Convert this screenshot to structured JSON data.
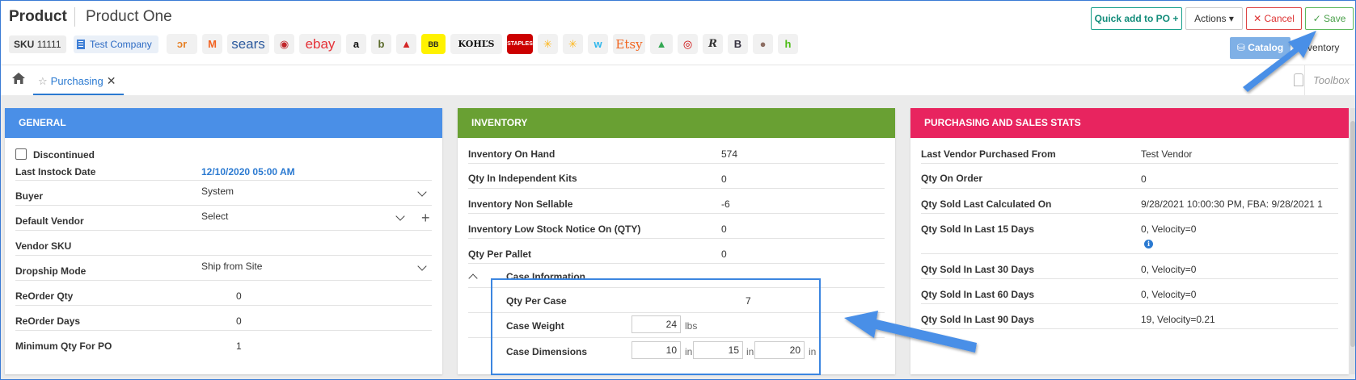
{
  "header": {
    "title": "Product",
    "subtitle": "Product One",
    "sku_label": "SKU",
    "sku_value": "11111",
    "company": "Test Company",
    "buttons": {
      "quick_add": "Quick add to PO +",
      "actions": "Actions ▾",
      "cancel": "✕ Cancel",
      "save": "✓ Save",
      "catalog": "Catalog",
      "inventory": "Inventory"
    }
  },
  "channels": [
    {
      "name": "channeladvisor-logo",
      "text": "ɔr",
      "color": "#e67e22",
      "w": 38
    },
    {
      "name": "magento-logo",
      "text": "M",
      "color": "#f26322",
      "w": 25
    },
    {
      "name": "sears-logo",
      "text": "sears",
      "color": "#2c5a9e",
      "w": 52
    },
    {
      "name": "rakuten-logo",
      "text": "◉",
      "color": "#c0262b",
      "w": 25
    },
    {
      "name": "ebay-logo",
      "text": "ebay",
      "color": "#e53238",
      "w": 52
    },
    {
      "name": "amazon-logo",
      "text": "a",
      "color": "#111111",
      "w": 25
    },
    {
      "name": "bonanza-logo",
      "text": "b",
      "color": "#5b6b2b",
      "w": 25
    },
    {
      "name": "sears-hometown-logo",
      "text": "▲",
      "color": "#d42626",
      "w": 25
    },
    {
      "name": "bestbuy-logo",
      "text": "BB",
      "color": "#222222",
      "w": 30
    },
    {
      "name": "kohls-logo",
      "text": "KOHĽS",
      "color": "#111111",
      "w": 64
    },
    {
      "name": "staples-logo",
      "text": "STAPLES",
      "color": "#ffffff",
      "w": 32
    },
    {
      "name": "walmart-logo",
      "text": "✳",
      "color": "#ffb617",
      "w": 25
    },
    {
      "name": "walmart-ca-logo",
      "text": "✳",
      "color": "#ffb617",
      "w": 25
    },
    {
      "name": "wish-logo",
      "text": "w",
      "color": "#2fb7ec",
      "w": 25
    },
    {
      "name": "etsy-logo",
      "text": "Etsy",
      "color": "#f1641e",
      "w": 40
    },
    {
      "name": "google-shopping-logo",
      "text": "▲",
      "color": "#34a853",
      "w": 28
    },
    {
      "name": "target-logo",
      "text": "◎",
      "color": "#cc0000",
      "w": 25
    },
    {
      "name": "reverb-logo",
      "text": "R",
      "color": "#333333",
      "w": 25
    },
    {
      "name": "bigcommerce-logo",
      "text": "B",
      "color": "#34313f",
      "w": 25
    },
    {
      "name": "globe-logo",
      "text": "●",
      "color": "#8d6e63",
      "w": 25
    },
    {
      "name": "houzz-logo",
      "text": "h",
      "color": "#4dbc15",
      "w": 25
    }
  ],
  "tabs": {
    "purchasing": "Purchasing",
    "toolbox": "Toolbox"
  },
  "general": {
    "title": "GENERAL",
    "discontinued": "Discontinued",
    "last_instock_label": "Last Instock Date",
    "last_instock_value": "12/10/2020 05:00 AM",
    "buyer_label": "Buyer",
    "buyer_value": "System",
    "default_vendor_label": "Default Vendor",
    "default_vendor_value": "Select",
    "vendor_sku_label": "Vendor SKU",
    "dropship_label": "Dropship Mode",
    "dropship_value": "Ship from Site",
    "reorder_qty_label": "ReOrder Qty",
    "reorder_qty_value": "0",
    "reorder_days_label": "ReOrder Days",
    "reorder_days_value": "0",
    "min_qty_label": "Minimum Qty For PO",
    "min_qty_value": "1"
  },
  "inventory": {
    "title": "INVENTORY",
    "rows": [
      {
        "label": "Inventory On Hand",
        "value": "574"
      },
      {
        "label": "Qty In Independent Kits",
        "value": "0"
      },
      {
        "label": "Inventory Non Sellable",
        "value": "-6"
      },
      {
        "label": "Inventory Low Stock Notice On (QTY)",
        "value": "0"
      },
      {
        "label": "Qty Per Pallet",
        "value": "0"
      }
    ],
    "case_info": "Case Information",
    "qty_per_case_label": "Qty Per Case",
    "qty_per_case_value": "7",
    "case_weight_label": "Case Weight",
    "case_weight_value": "24",
    "case_weight_unit": "lbs",
    "case_dim_label": "Case Dimensions",
    "dim_l": "10",
    "dim_w": "15",
    "dim_h": "20",
    "dim_unit": "in"
  },
  "stats": {
    "title": "PURCHASING AND SALES STATS",
    "rows": [
      {
        "label": "Last Vendor Purchased From",
        "value": "Test Vendor"
      },
      {
        "label": "Qty On Order",
        "value": "0"
      },
      {
        "label": "Qty Sold Last Calculated On",
        "value": "9/28/2021 10:00:30 PM, FBA: 9/28/2021 1"
      },
      {
        "label": "Qty Sold In Last 15 Days",
        "value": "0, Velocity=0"
      },
      {
        "label": "Qty Sold In Last 30 Days",
        "value": "0, Velocity=0"
      },
      {
        "label": "Qty Sold In Last 60 Days",
        "value": "0, Velocity=0"
      },
      {
        "label": "Qty Sold In Last 90 Days",
        "value": "19, Velocity=0.21"
      }
    ]
  }
}
